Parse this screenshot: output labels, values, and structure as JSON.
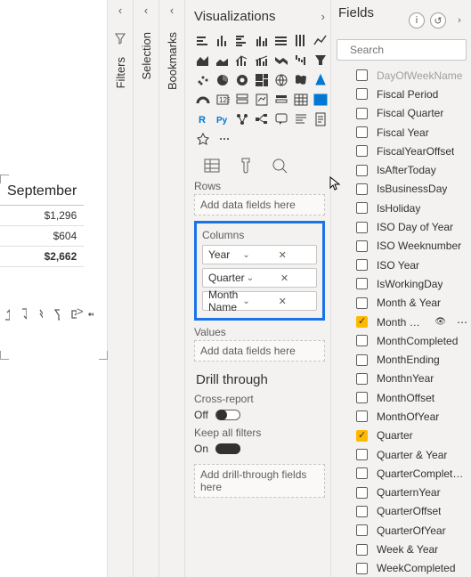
{
  "canvas": {
    "month_header": "September",
    "rows": [
      "$1,296",
      "$604",
      "$2,662"
    ],
    "scroll_hint": ">"
  },
  "rails": {
    "filters": "Filters",
    "selection": "Selection",
    "bookmarks": "Bookmarks"
  },
  "viz": {
    "title": "Visualizations",
    "rows_label": "Rows",
    "rows_placeholder": "Add data fields here",
    "columns_label": "Columns",
    "columns_pills": [
      "Year",
      "Quarter",
      "Month Name"
    ],
    "values_label": "Values",
    "values_placeholder": "Add data fields here",
    "drill_title": "Drill through",
    "cross_label": "Cross-report",
    "cross_state": "Off",
    "keep_label": "Keep all filters",
    "keep_state": "On",
    "drill_placeholder": "Add drill-through fields here"
  },
  "fields": {
    "title": "Fields",
    "search_placeholder": "Search",
    "items": [
      {
        "name": "DayOfWeekName",
        "checked": false,
        "cut": true
      },
      {
        "name": "Fiscal Period",
        "checked": false
      },
      {
        "name": "Fiscal Quarter",
        "checked": false
      },
      {
        "name": "Fiscal Year",
        "checked": false
      },
      {
        "name": "FiscalYearOffset",
        "checked": false
      },
      {
        "name": "IsAfterToday",
        "checked": false
      },
      {
        "name": "IsBusinessDay",
        "checked": false
      },
      {
        "name": "IsHoliday",
        "checked": false
      },
      {
        "name": "ISO Day of Year",
        "checked": false
      },
      {
        "name": "ISO Weeknumber",
        "checked": false
      },
      {
        "name": "ISO Year",
        "checked": false
      },
      {
        "name": "IsWorkingDay",
        "checked": false
      },
      {
        "name": "Month & Year",
        "checked": false
      },
      {
        "name": "Month Na…",
        "checked": true,
        "selected": true
      },
      {
        "name": "MonthCompleted",
        "checked": false
      },
      {
        "name": "MonthEnding",
        "checked": false
      },
      {
        "name": "MonthnYear",
        "checked": false
      },
      {
        "name": "MonthOffset",
        "checked": false
      },
      {
        "name": "MonthOfYear",
        "checked": false
      },
      {
        "name": "Quarter",
        "checked": true
      },
      {
        "name": "Quarter & Year",
        "checked": false
      },
      {
        "name": "QuarterComplet…",
        "checked": false
      },
      {
        "name": "QuarternYear",
        "checked": false
      },
      {
        "name": "QuarterOffset",
        "checked": false
      },
      {
        "name": "QuarterOfYear",
        "checked": false
      },
      {
        "name": "Week & Year",
        "checked": false
      },
      {
        "name": "WeekCompleted",
        "checked": false
      }
    ]
  }
}
